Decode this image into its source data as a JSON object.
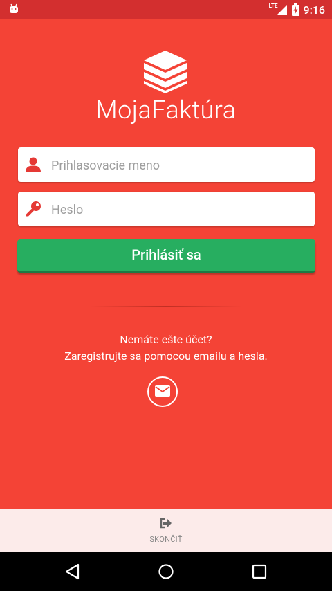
{
  "status_bar": {
    "time": "9:16",
    "network": "LTE",
    "icons": [
      "android-notification-icon",
      "lte-signal-icon",
      "battery-icon"
    ]
  },
  "app": {
    "brand": "MojaFaktúra",
    "username_placeholder": "Prihlasovacie meno",
    "password_placeholder": "Heslo",
    "login_label": "Prihlásiť sa",
    "register_line1": "Nemáte ešte účet?",
    "register_line2": "Zaregistrujte sa pomocou emailu a hesla.",
    "quit_label": "SKONČIŤ"
  },
  "colors": {
    "background": "#f44336",
    "status_bar": "#d32f2f",
    "login_button": "#27ae60",
    "bottom_bar": "#fcebea"
  },
  "nav": {
    "icons": [
      "back-icon",
      "home-icon",
      "recents-icon"
    ]
  }
}
